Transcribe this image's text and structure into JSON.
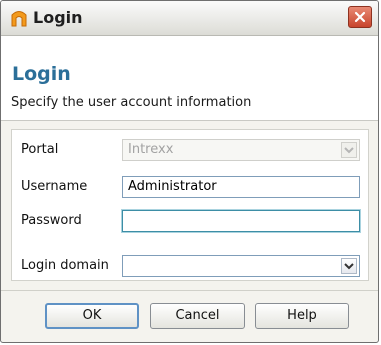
{
  "window": {
    "title": "Login",
    "close_icon": "close-icon",
    "app_icon": "intrexx-arch-icon"
  },
  "header": {
    "title": "Login",
    "subtitle": "Specify the user account information"
  },
  "form": {
    "portal": {
      "label": "Portal",
      "value": "Intrexx",
      "disabled": true
    },
    "username": {
      "label": "Username",
      "value": "Administrator"
    },
    "password": {
      "label": "Password",
      "value": ""
    },
    "login_domain": {
      "label": "Login domain",
      "value": ""
    }
  },
  "buttons": {
    "ok": "OK",
    "cancel": "Cancel",
    "help": "Help"
  },
  "colors": {
    "accent_title": "#2b6f99",
    "close_red": "#c8442c",
    "app_icon_orange": "#f39a1c"
  }
}
